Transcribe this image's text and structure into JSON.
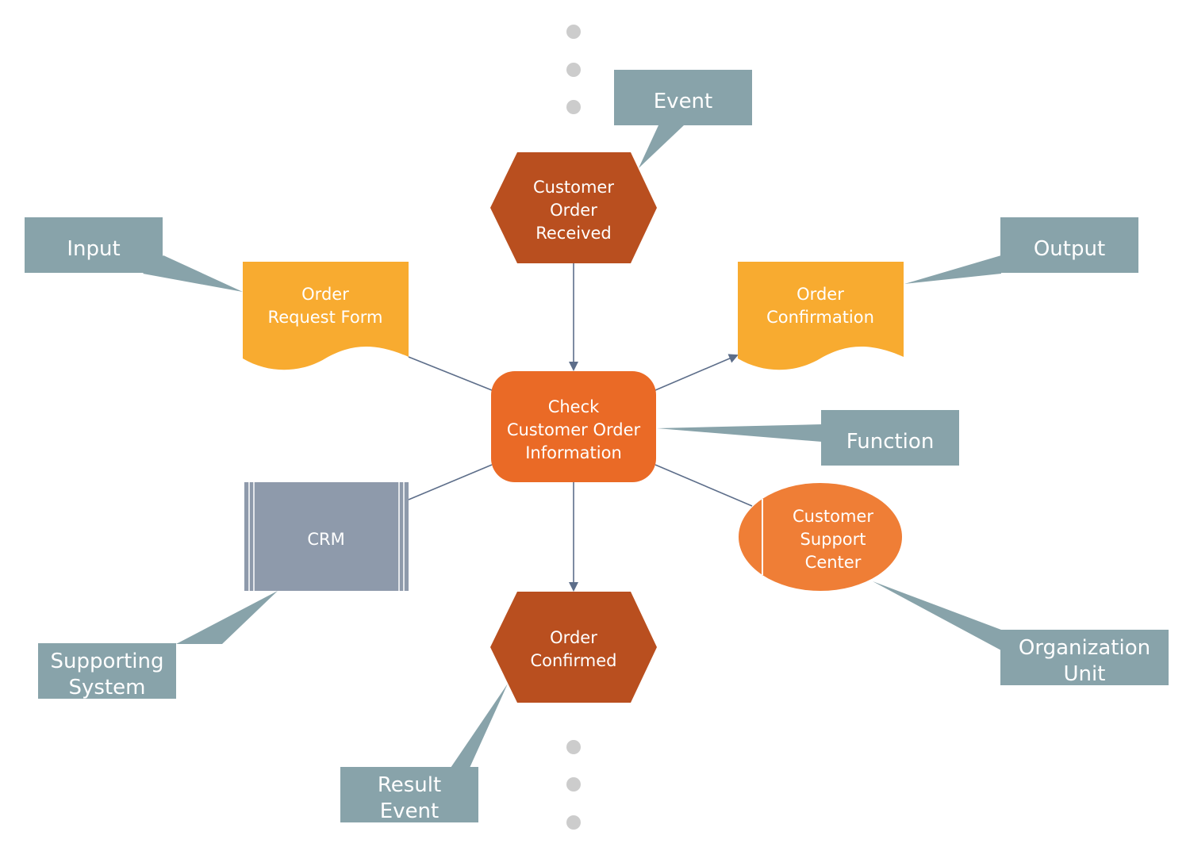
{
  "diagram": {
    "type": "EPC (Event-driven Process Chain) legend",
    "colors": {
      "event": "#b94f1f",
      "function": "#ea6a26",
      "document": "#f8ab30",
      "system": "#8e9aab",
      "org_unit": "#ef7e36",
      "callout": "#88a3aa",
      "connector": "#5d6e8a",
      "ellipsis_dot": "#cccccc"
    },
    "nodes": {
      "event_top": {
        "kind": "event",
        "lines": [
          "Customer",
          "Order",
          "Received"
        ]
      },
      "function": {
        "kind": "function",
        "lines": [
          "Check",
          "Customer Order",
          "Information"
        ]
      },
      "input_doc": {
        "kind": "document",
        "lines": [
          "Order",
          "Request Form"
        ]
      },
      "output_doc": {
        "kind": "document",
        "lines": [
          "Order",
          "Confirmation"
        ]
      },
      "system": {
        "kind": "information-system",
        "lines": [
          "CRM"
        ]
      },
      "org_unit": {
        "kind": "organization-unit",
        "lines": [
          "Customer",
          "Support",
          "Center"
        ]
      },
      "event_bottom": {
        "kind": "event",
        "lines": [
          "Order",
          "Confirmed"
        ]
      }
    },
    "callouts": {
      "event": {
        "lines": [
          "Event"
        ]
      },
      "input": {
        "lines": [
          "Input"
        ]
      },
      "output": {
        "lines": [
          "Output"
        ]
      },
      "function": {
        "lines": [
          "Function"
        ]
      },
      "supporting_system": {
        "lines": [
          "Supporting",
          "System"
        ]
      },
      "organization_unit": {
        "lines": [
          "Organization",
          "Unit"
        ]
      },
      "result_event": {
        "lines": [
          "Result",
          "Event"
        ]
      }
    },
    "edges": [
      {
        "from": "event_top",
        "to": "function",
        "arrow": true
      },
      {
        "from": "function",
        "to": "output_doc",
        "arrow": true
      },
      {
        "from": "function",
        "to": "event_bottom",
        "arrow": true
      },
      {
        "from": "input_doc",
        "to": "function",
        "arrow": false
      },
      {
        "from": "system",
        "to": "function",
        "arrow": false
      },
      {
        "from": "org_unit",
        "to": "function",
        "arrow": false
      }
    ]
  }
}
